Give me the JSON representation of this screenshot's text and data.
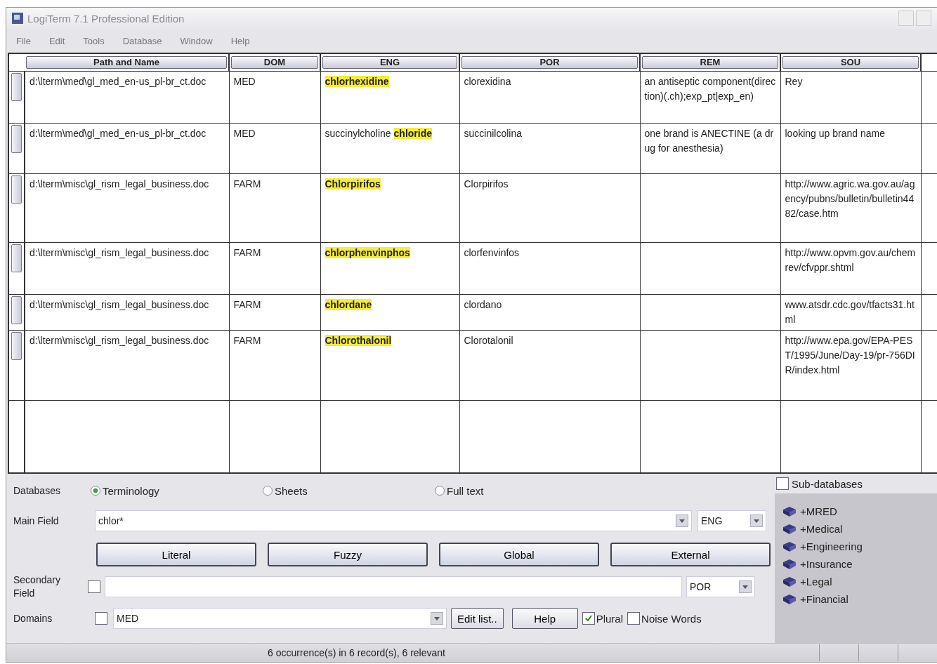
{
  "window": {
    "title": "LogiTerm 7.1 Professional Edition"
  },
  "menu": [
    "File",
    "Edit",
    "Tools",
    "Database",
    "Window",
    "Help"
  ],
  "table": {
    "columns": [
      "Path and Name",
      "DOM",
      "ENG",
      "POR",
      "REM",
      "SOU"
    ],
    "rows": [
      {
        "path": "d:\\lterm\\med\\gl_med_en-us_pl-br_ct.doc",
        "dom": "MED",
        "eng": [
          {
            "text": "chlorhexidine",
            "highlight": true
          }
        ],
        "por": "clorexidina",
        "rem": "an antiseptic component(direction)(.ch);exp_pt|exp_en)",
        "sou": "Rey"
      },
      {
        "path": "d:\\lterm\\med\\gl_med_en-us_pl-br_ct.doc",
        "dom": "MED",
        "eng": [
          {
            "text": "succinylcholine ",
            "highlight": false
          },
          {
            "text": "chloride",
            "highlight": true
          }
        ],
        "por": "succinilcolina",
        "rem": "one brand is ANECTINE (a drug for anesthesia)",
        "sou": "looking up brand name"
      },
      {
        "path": "d:\\lterm\\misc\\gl_rism_legal_business.doc",
        "dom": "FARM",
        "eng": [
          {
            "text": "Chlorpirifos",
            "highlight": true
          }
        ],
        "por": "Clorpirifos",
        "rem": "",
        "sou": "http://www.agric.wa.gov.au/agency/pubns/bulletin/bulletin4482/case.htm"
      },
      {
        "path": "d:\\lterm\\misc\\gl_rism_legal_business.doc",
        "dom": "FARM",
        "eng": [
          {
            "text": "chlorphenvinphos",
            "highlight": true
          }
        ],
        "por": "clorfenvinfos",
        "rem": "",
        "sou": "http://www.opvm.gov.au/chemrev/cfvppr.shtml"
      },
      {
        "path": "d:\\lterm\\misc\\gl_rism_legal_business.doc",
        "dom": "FARM",
        "eng": [
          {
            "text": "chlordane",
            "highlight": true
          }
        ],
        "por": "clordano",
        "rem": "",
        "sou": "www.atsdr.cdc.gov/tfacts31.html"
      },
      {
        "path": "d:\\lterm\\misc\\gl_rism_legal_business.doc",
        "dom": "FARM",
        "eng": [
          {
            "text": "Chlorothalonil",
            "highlight": true
          }
        ],
        "por": "Clorotalonil",
        "rem": "",
        "sou": "http://www.epa.gov/EPA-PEST/1995/June/Day-19/pr-756DIR/index.html"
      }
    ]
  },
  "databases": {
    "label": "Databases",
    "options": [
      {
        "label": "Terminology",
        "selected": true
      },
      {
        "label": "Sheets",
        "selected": false
      },
      {
        "label": "Full text",
        "selected": false
      }
    ]
  },
  "main_field": {
    "label": "Main Field",
    "value": "chlor*",
    "language": "ENG"
  },
  "search_buttons": [
    "Literal",
    "Fuzzy",
    "Global",
    "External"
  ],
  "secondary_field": {
    "label": "Secondary Field",
    "checked": false,
    "language": "POR"
  },
  "domains": {
    "label": "Domains",
    "checked": false,
    "value": "MED",
    "edit_button": "Edit list..",
    "help_button": "Help"
  },
  "options": [
    {
      "label": "Plural",
      "checked": true
    },
    {
      "label": "Noise Words",
      "checked": false
    }
  ],
  "sub_databases": {
    "label": "Sub-databases",
    "checked": false,
    "items": [
      "+MRED",
      "+Medical",
      "+Engineering",
      "+Insurance",
      "+Legal",
      "+Financial"
    ]
  },
  "status_bar": "6 occurrence(s) in 6 record(s), 6 relevant"
}
